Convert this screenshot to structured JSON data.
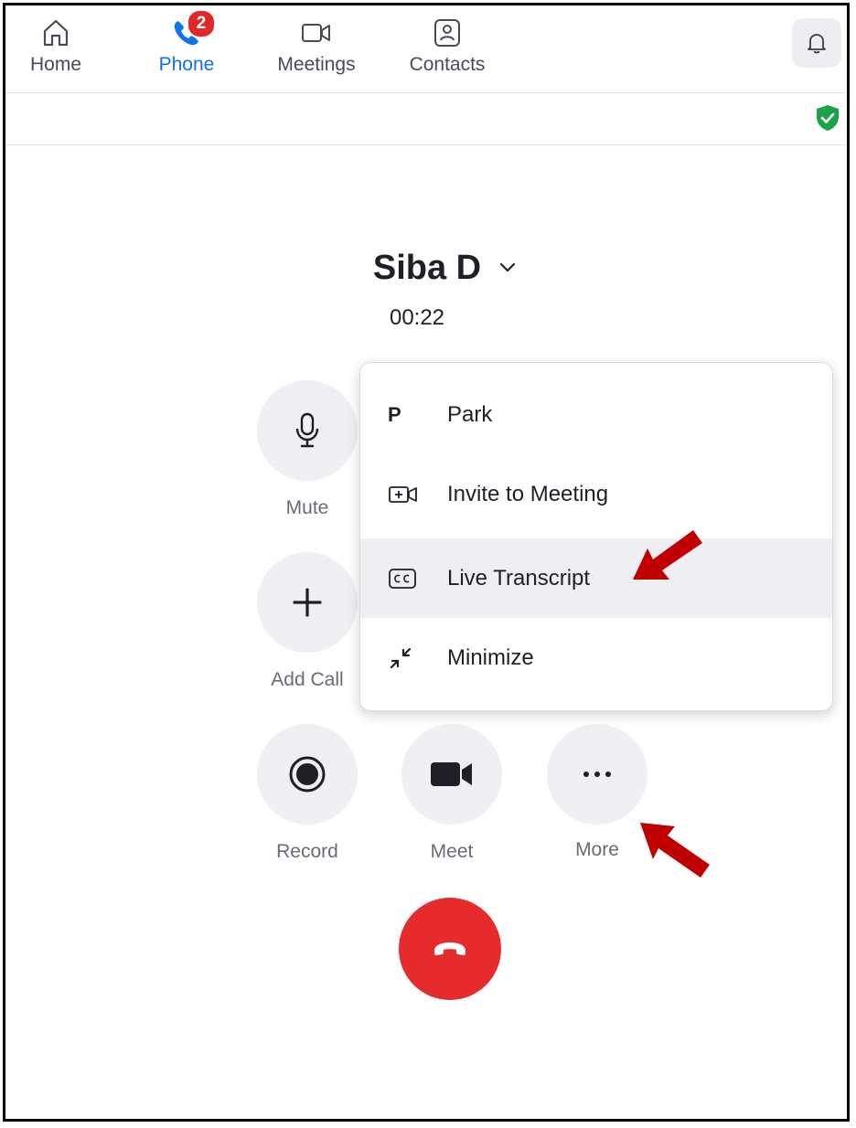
{
  "nav": {
    "home_label": "Home",
    "phone_label": "Phone",
    "phone_badge": "2",
    "meetings_label": "Meetings",
    "contacts_label": "Contacts",
    "active_color": "#0e72ed"
  },
  "call": {
    "caller_name": "Siba D",
    "timer": "00:22"
  },
  "controls": {
    "mute_label": "Mute",
    "add_call_label": "Add Call",
    "record_label": "Record",
    "meet_label": "Meet",
    "more_label": "More"
  },
  "menu": {
    "items": [
      {
        "icon_text": "P",
        "label": "Park"
      },
      {
        "label": "Invite to Meeting"
      },
      {
        "label": "Live Transcript"
      },
      {
        "label": "Minimize"
      }
    ],
    "highlighted": "Live Transcript"
  },
  "colors": {
    "hangup": "#e52b2b",
    "badge": "#e02828",
    "shield": "#1aa34a",
    "annotation_arrow": "#c00000"
  }
}
